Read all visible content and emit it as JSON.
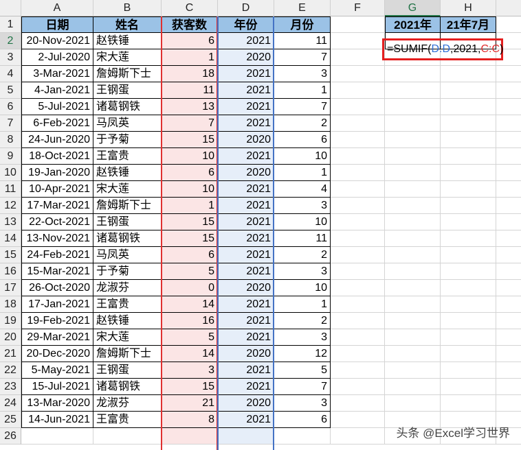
{
  "columns": [
    "A",
    "B",
    "C",
    "D",
    "E",
    "F",
    "G",
    "H"
  ],
  "selected_column": "G",
  "selected_row": "2",
  "header_row": {
    "A": "日期",
    "B": "姓名",
    "C": "获客数",
    "D": "年份",
    "E": "月份",
    "G": "2021年",
    "H": "21年7月"
  },
  "rows": [
    [
      "20-Nov-2021",
      "赵铁锤",
      "6",
      "2021",
      "11"
    ],
    [
      "2-Jul-2020",
      "宋大莲",
      "1",
      "2020",
      "7"
    ],
    [
      "3-Mar-2021",
      "詹姆斯下士",
      "18",
      "2021",
      "3"
    ],
    [
      "4-Jan-2021",
      "王钢蛋",
      "11",
      "2021",
      "1"
    ],
    [
      "5-Jul-2021",
      "诸葛钢铁",
      "13",
      "2021",
      "7"
    ],
    [
      "6-Feb-2021",
      "马凤英",
      "7",
      "2021",
      "2"
    ],
    [
      "24-Jun-2020",
      "于予菊",
      "15",
      "2020",
      "6"
    ],
    [
      "18-Oct-2021",
      "王富贵",
      "10",
      "2021",
      "10"
    ],
    [
      "19-Jan-2020",
      "赵铁锤",
      "6",
      "2020",
      "1"
    ],
    [
      "10-Apr-2021",
      "宋大莲",
      "10",
      "2021",
      "4"
    ],
    [
      "17-Mar-2021",
      "詹姆斯下士",
      "1",
      "2021",
      "3"
    ],
    [
      "22-Oct-2021",
      "王钢蛋",
      "15",
      "2021",
      "10"
    ],
    [
      "13-Nov-2021",
      "诸葛钢铁",
      "15",
      "2021",
      "11"
    ],
    [
      "24-Feb-2021",
      "马凤英",
      "6",
      "2021",
      "2"
    ],
    [
      "15-Mar-2021",
      "于予菊",
      "5",
      "2021",
      "3"
    ],
    [
      "26-Oct-2020",
      "龙淑芬",
      "0",
      "2020",
      "10"
    ],
    [
      "17-Jan-2021",
      "王富贵",
      "14",
      "2021",
      "1"
    ],
    [
      "19-Feb-2021",
      "赵铁锤",
      "16",
      "2021",
      "2"
    ],
    [
      "29-Mar-2021",
      "宋大莲",
      "5",
      "2021",
      "3"
    ],
    [
      "20-Dec-2020",
      "詹姆斯下士",
      "14",
      "2020",
      "12"
    ],
    [
      "5-May-2021",
      "王钢蛋",
      "3",
      "2021",
      "5"
    ],
    [
      "15-Jul-2021",
      "诸葛钢铁",
      "15",
      "2021",
      "7"
    ],
    [
      "13-Mar-2020",
      "龙淑芬",
      "21",
      "2020",
      "3"
    ],
    [
      "14-Jun-2021",
      "王富贵",
      "8",
      "2021",
      "6"
    ]
  ],
  "formula": {
    "prefix": "=SUMIF(",
    "range": "D:D",
    "sep1": ",2021,",
    "sum_range": "C:C",
    "suffix": ")"
  },
  "watermark": "头条 @Excel学习世界",
  "colors": {
    "header_fill": "#9bc2e6",
    "highlight_C": "#fbe5e5",
    "highlight_D": "#e6eef9",
    "formula_box": "#e41e1e"
  }
}
